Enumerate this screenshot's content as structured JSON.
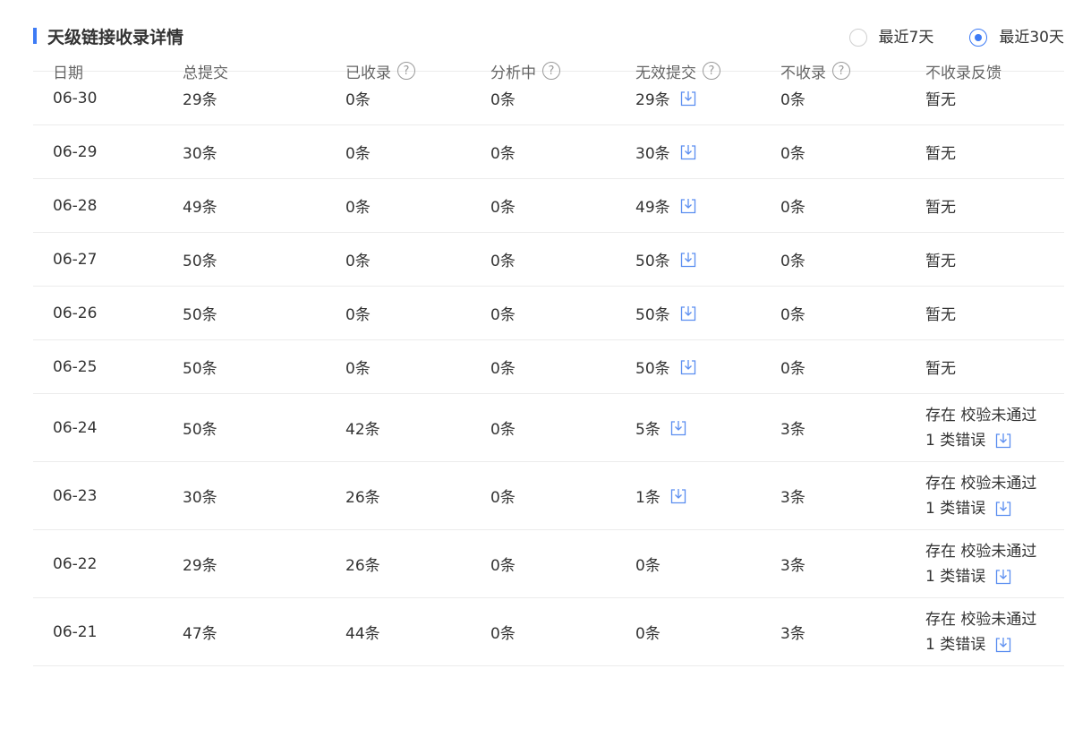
{
  "header": {
    "title": "天级链接收录详情",
    "range_options": [
      {
        "label": "最近7天",
        "checked": false
      },
      {
        "label": "最近30天",
        "checked": true
      }
    ]
  },
  "table": {
    "columns": [
      "日期",
      "总提交",
      "已收录",
      "分析中",
      "无效提交",
      "不收录",
      "不收录反馈"
    ],
    "rows": [
      {
        "date": "06-30",
        "total": "29条",
        "indexed": "0条",
        "analyzing": "0条",
        "invalid": "29条",
        "invalid_dl": true,
        "not_indexed": "0条",
        "feedback": "暂无"
      },
      {
        "date": "06-29",
        "total": "30条",
        "indexed": "0条",
        "analyzing": "0条",
        "invalid": "30条",
        "invalid_dl": true,
        "not_indexed": "0条",
        "feedback": "暂无"
      },
      {
        "date": "06-28",
        "total": "49条",
        "indexed": "0条",
        "analyzing": "0条",
        "invalid": "49条",
        "invalid_dl": true,
        "not_indexed": "0条",
        "feedback": "暂无"
      },
      {
        "date": "06-27",
        "total": "50条",
        "indexed": "0条",
        "analyzing": "0条",
        "invalid": "50条",
        "invalid_dl": true,
        "not_indexed": "0条",
        "feedback": "暂无"
      },
      {
        "date": "06-26",
        "total": "50条",
        "indexed": "0条",
        "analyzing": "0条",
        "invalid": "50条",
        "invalid_dl": true,
        "not_indexed": "0条",
        "feedback": "暂无"
      },
      {
        "date": "06-25",
        "total": "50条",
        "indexed": "0条",
        "analyzing": "0条",
        "invalid": "50条",
        "invalid_dl": true,
        "not_indexed": "0条",
        "feedback": "暂无"
      },
      {
        "date": "06-24",
        "total": "50条",
        "indexed": "42条",
        "analyzing": "0条",
        "invalid": "5条",
        "invalid_dl": true,
        "not_indexed": "3条",
        "feedback_line1": "存在 校验未通过",
        "feedback_line2": "1 类错误"
      },
      {
        "date": "06-23",
        "total": "30条",
        "indexed": "26条",
        "analyzing": "0条",
        "invalid": "1条",
        "invalid_dl": true,
        "not_indexed": "3条",
        "feedback_line1": "存在 校验未通过",
        "feedback_line2": "1 类错误"
      },
      {
        "date": "06-22",
        "total": "29条",
        "indexed": "26条",
        "analyzing": "0条",
        "invalid": "0条",
        "invalid_dl": false,
        "not_indexed": "3条",
        "feedback_line1": "存在 校验未通过",
        "feedback_line2": "1 类错误"
      },
      {
        "date": "06-21",
        "total": "47条",
        "indexed": "44条",
        "analyzing": "0条",
        "invalid": "0条",
        "invalid_dl": false,
        "not_indexed": "3条",
        "feedback_line1": "存在 校验未通过",
        "feedback_line2": "1 类错误"
      }
    ]
  },
  "colors": {
    "accent": "#3d7bf5",
    "header_bg": "#f7f7f7",
    "icon": "#5b8ef0"
  },
  "help_glyph": "?"
}
